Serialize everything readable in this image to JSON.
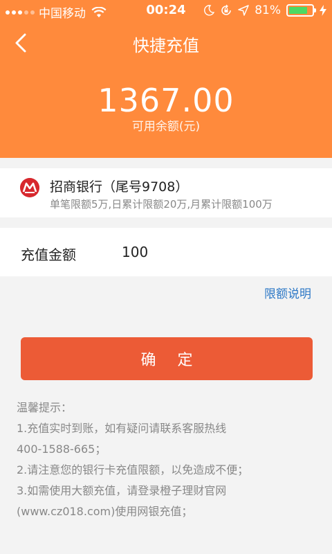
{
  "status_bar": {
    "carrier": "中国移动",
    "time": "00:24",
    "battery_percent": "81%",
    "battery_level": 0.81,
    "icons": [
      "signal-icon",
      "wifi-icon",
      "moon-icon",
      "rotation-lock-icon",
      "location-icon",
      "battery-icon",
      "charging-icon"
    ]
  },
  "nav": {
    "title": "快捷充值",
    "back_icon": "chevron-left-icon"
  },
  "balance": {
    "amount": "1367.00",
    "label": "可用余额(元)"
  },
  "bank": {
    "name": "招商银行（尾号9708）",
    "limit": "单笔限额5万,日累计限额20万,月累计限额100万",
    "logo_icon": "cmb-bank-logo-icon",
    "logo_color": "#d7282e"
  },
  "amount": {
    "label": "充值金额",
    "value": "100"
  },
  "limit_link": "限额说明",
  "confirm_label": "确 定",
  "tips": {
    "title": "温馨提示：",
    "lines": [
      "1.充值实时到账，如有疑问请联系客服热线",
      "400-1588-665；",
      "2.请注意您的银行卡充值限额，以免造成不便；",
      "3.如需使用大额充值，请登录橙子理财官网",
      "(www.cz018.com)使用网银充值；"
    ]
  },
  "colors": {
    "header_bg": "#ff8a3c",
    "button_bg": "#ec5b36",
    "link": "#2b77c6",
    "battery_fill": "#4cd964"
  }
}
